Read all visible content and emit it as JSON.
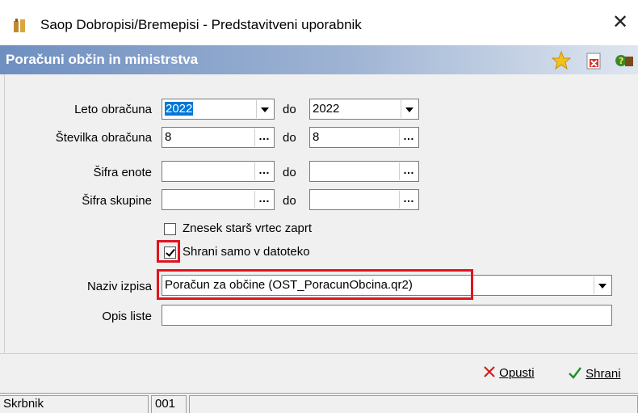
{
  "window": {
    "title": "Saop Dobropisi/Bremepisi - Predstavitveni uporabnik"
  },
  "header": {
    "title": "Poračuni občin in ministrstva"
  },
  "form": {
    "leto_label": "Leto obračuna",
    "leto_from": "2022",
    "leto_to": "2022",
    "stevilka_label": "Številka obračuna",
    "stevilka_from": "8",
    "stevilka_to": "8",
    "sifra_enote_label": "Šifra enote",
    "sifra_enote_from": "",
    "sifra_enote_to": "",
    "sifra_skupine_label": "Šifra skupine",
    "sifra_skupine_from": "",
    "sifra_skupine_to": "",
    "do_label": "do",
    "chk_znesek_label": "Znesek starš vrtec zaprt",
    "chk_znesek_checked": false,
    "chk_shrani_label": "Shrani samo v datoteko",
    "chk_shrani_checked": true,
    "naziv_label": "Naziv izpisa",
    "naziv_value": "Poračun za občine  (OST_PoracunObcina.qr2)",
    "opis_label": "Opis liste",
    "opis_value": ""
  },
  "footer": {
    "opusti_label": "Opusti",
    "shrani_label": "Shrani"
  },
  "status": {
    "user": "Skrbnik",
    "code": "001"
  },
  "colors": {
    "highlight": "#e0141e",
    "selection": "#0078d7",
    "header_start": "#6e8fc0"
  },
  "icons": [
    "app-icon",
    "close-icon",
    "star-icon",
    "delete-doc-icon",
    "help-icon",
    "cancel-x-icon",
    "checkmark-icon"
  ]
}
